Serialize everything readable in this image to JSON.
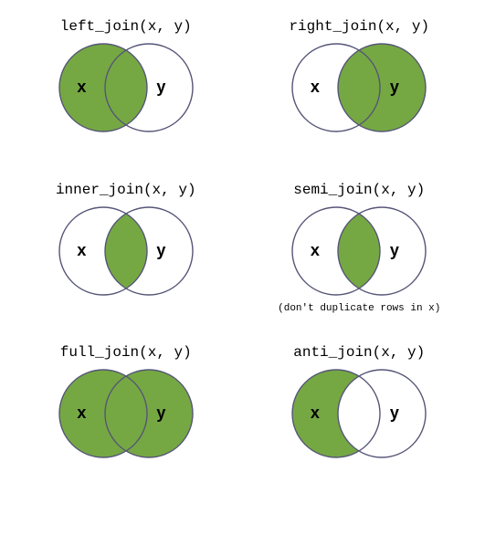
{
  "diagrams": [
    {
      "title": "left_join(x, y)",
      "type": "left",
      "xLabel": "x",
      "yLabel": "y",
      "subtitle": ""
    },
    {
      "title": "right_join(x, y)",
      "type": "right",
      "xLabel": "x",
      "yLabel": "y",
      "subtitle": ""
    },
    {
      "title": "inner_join(x, y)",
      "type": "inner",
      "xLabel": "x",
      "yLabel": "y",
      "subtitle": ""
    },
    {
      "title": "semi_join(x, y)",
      "type": "inner",
      "xLabel": "x",
      "yLabel": "y",
      "subtitle": "(don't duplicate rows in x)"
    },
    {
      "title": "full_join(x, y)",
      "type": "full",
      "xLabel": "x",
      "yLabel": "y",
      "subtitle": ""
    },
    {
      "title": "anti_join(x, y)",
      "type": "anti",
      "xLabel": "x",
      "yLabel": "y",
      "subtitle": ""
    }
  ],
  "colors": {
    "fill": "#75a843",
    "stroke": "#555577"
  }
}
